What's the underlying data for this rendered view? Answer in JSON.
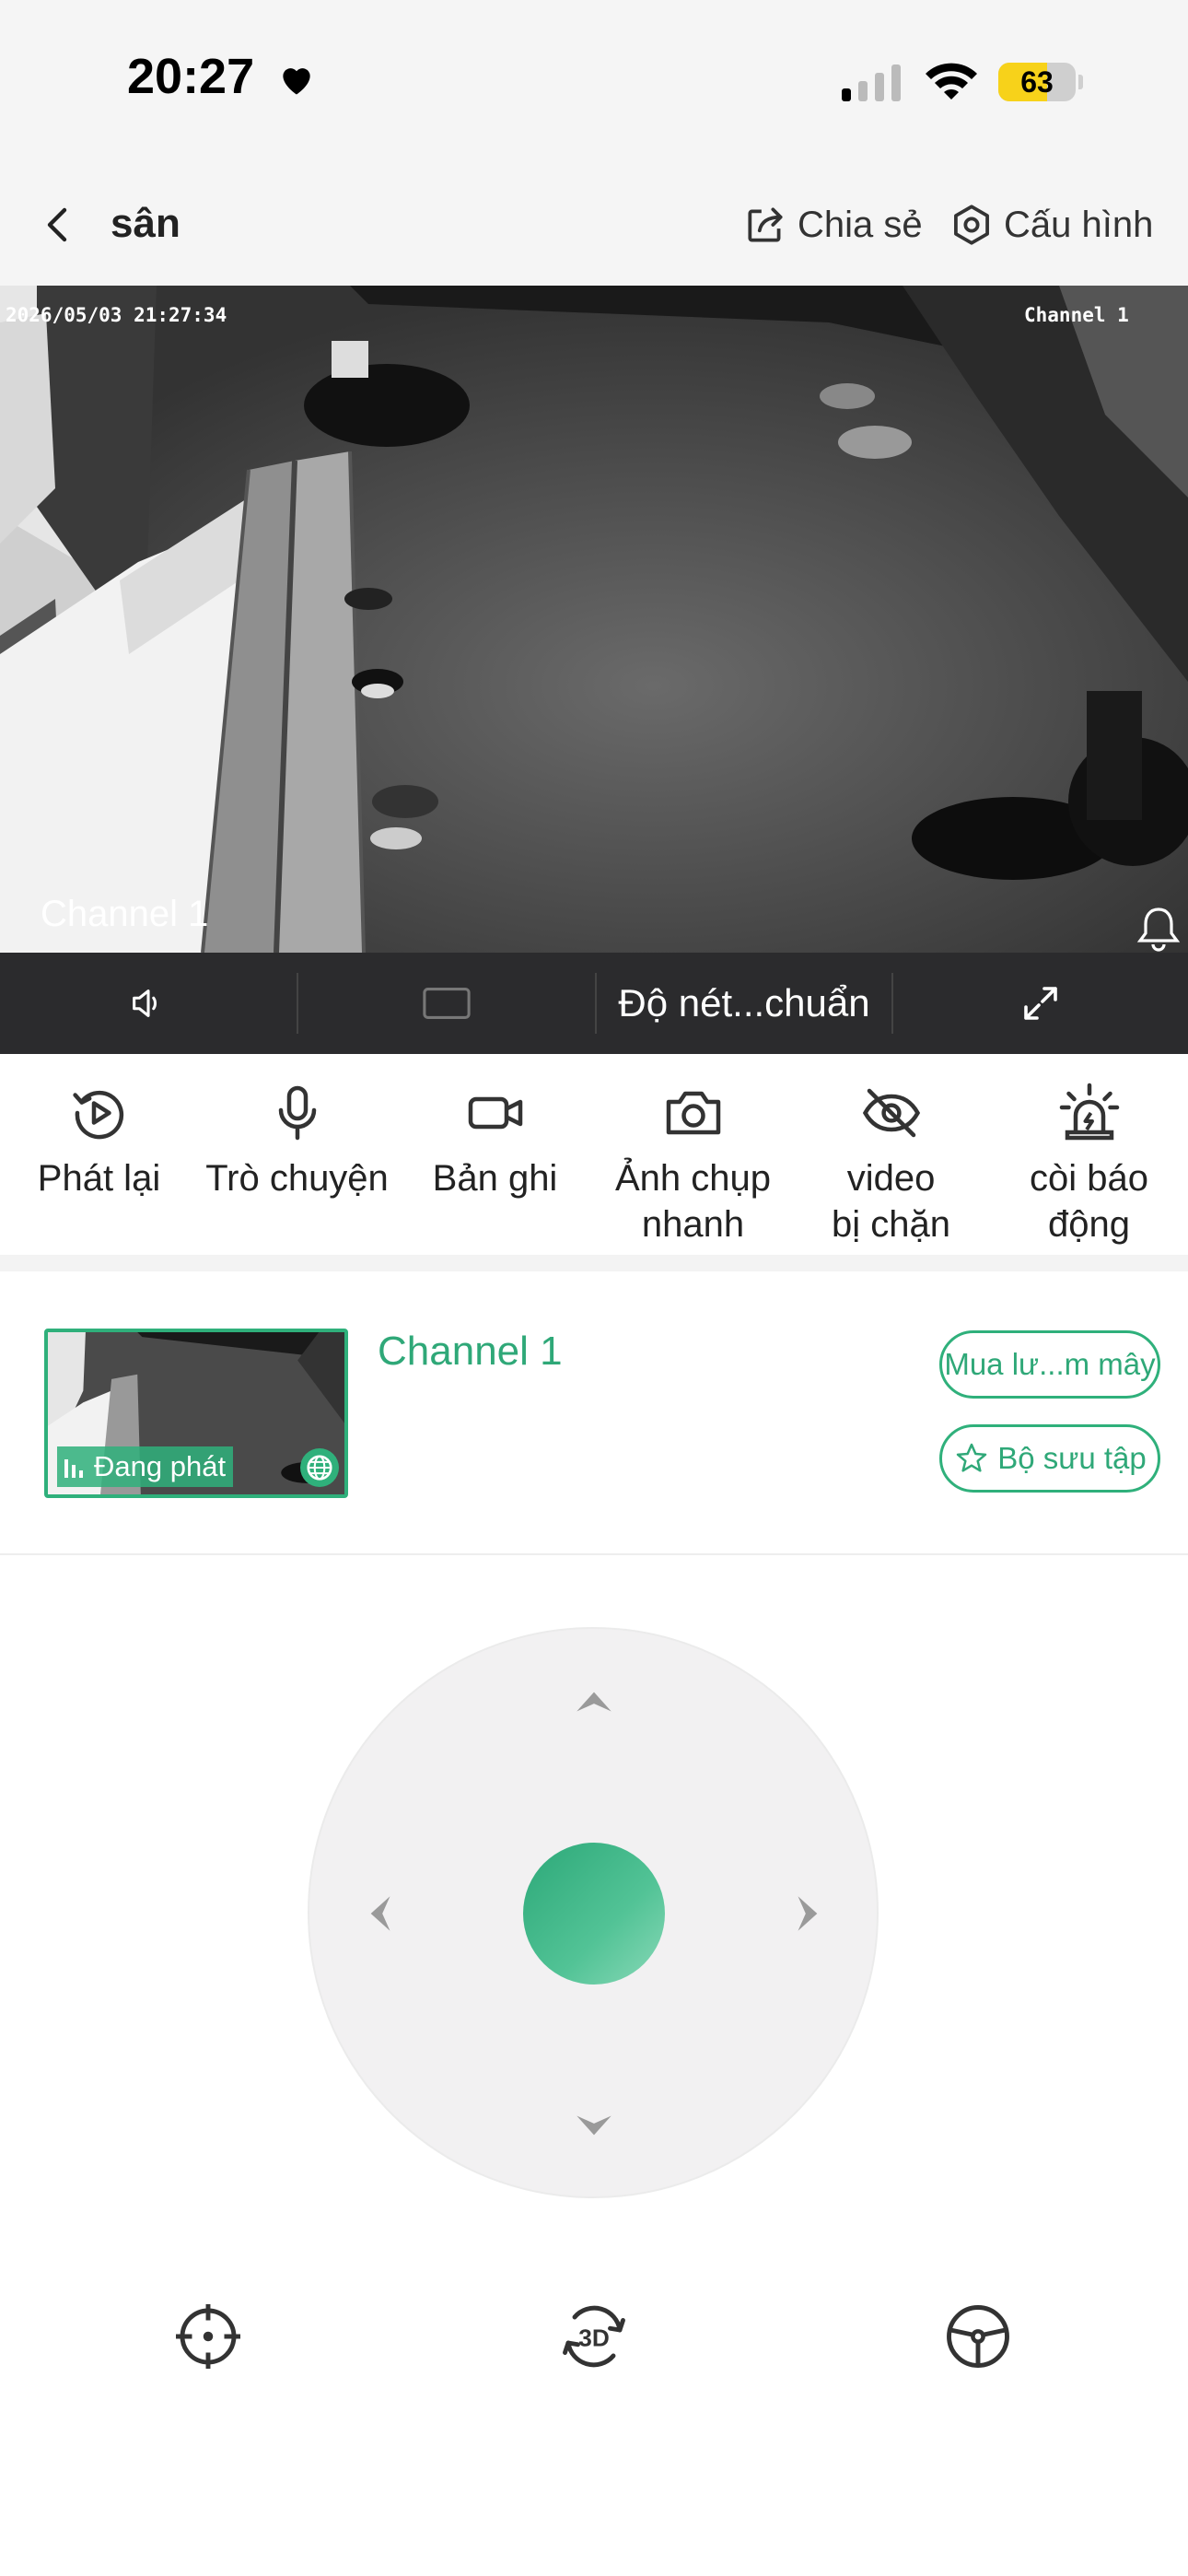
{
  "status_bar": {
    "time": "20:27",
    "battery": "63",
    "battery_level_percent": 63,
    "battery_color": "#f7d21a"
  },
  "header": {
    "title": "sân",
    "share_label": "Chia sẻ",
    "settings_label": "Cấu hình"
  },
  "video": {
    "timestamp": "2026/05/03 21:27:34",
    "osd_channel": "Channel 1",
    "channel_label": "Channel 1"
  },
  "video_toolbar": {
    "quality_label": "Độ nét...chuẩn",
    "icons": [
      "speaker-icon",
      "aspect-ratio-icon",
      "fullscreen-icon"
    ]
  },
  "actions": [
    {
      "label": "Phát lại",
      "icon": "playback-icon"
    },
    {
      "label": "Trò chuyện",
      "icon": "microphone-icon"
    },
    {
      "label": "Bản ghi",
      "icon": "record-icon"
    },
    {
      "label": "Ảnh chụp\nnhanh",
      "icon": "camera-icon"
    },
    {
      "label": "video\nbị chặn",
      "icon": "eye-off-icon"
    },
    {
      "label": "còi báo\nđộng",
      "icon": "alarm-icon"
    }
  ],
  "channel": {
    "name": "Channel 1",
    "status": "Đang phát",
    "cloud_button": "Mua lư...m mây",
    "collection_button": "Bộ sưu tập"
  },
  "ptz": {
    "accent_color": "#2fb07b",
    "controls": [
      "up",
      "down",
      "left",
      "right"
    ]
  },
  "bottom_tools": [
    "preset-target-icon",
    "3d-rotate-icon",
    "cruise-wheel-icon"
  ]
}
